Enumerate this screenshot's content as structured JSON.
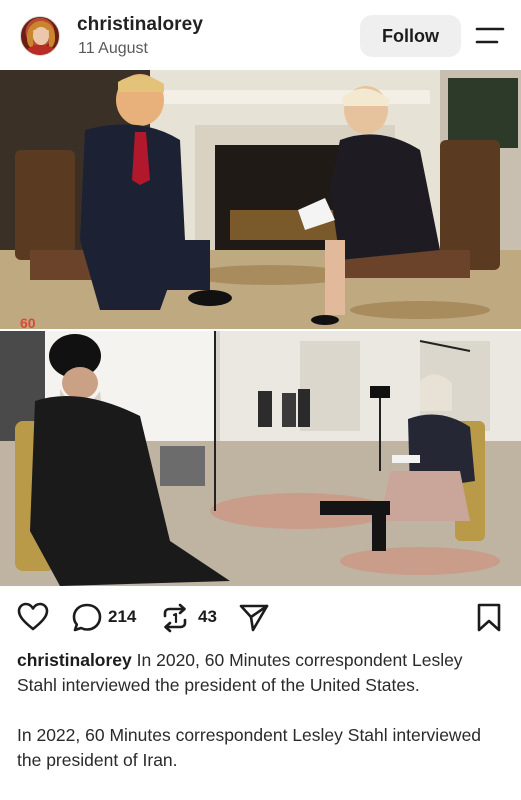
{
  "post": {
    "username": "christinalorey",
    "date": "11 August",
    "follow_label": "Follow"
  },
  "images": [
    {
      "name": "top-photo",
      "watermark": "60"
    },
    {
      "name": "bottom-photo"
    }
  ],
  "actions": {
    "comments": "214",
    "reposts": "43"
  },
  "caption": {
    "username": "christinalorey",
    "paragraph1": "In 2020, 60 Minutes correspondent Lesley Stahl interviewed the president of the United States.",
    "paragraph2": "In 2022, 60 Minutes correspondent Lesley Stahl interviewed the president of Iran."
  },
  "icons": [
    "avatar",
    "menu-icon",
    "heart-icon",
    "comment-icon",
    "repost-icon",
    "share-icon",
    "bookmark-icon"
  ]
}
